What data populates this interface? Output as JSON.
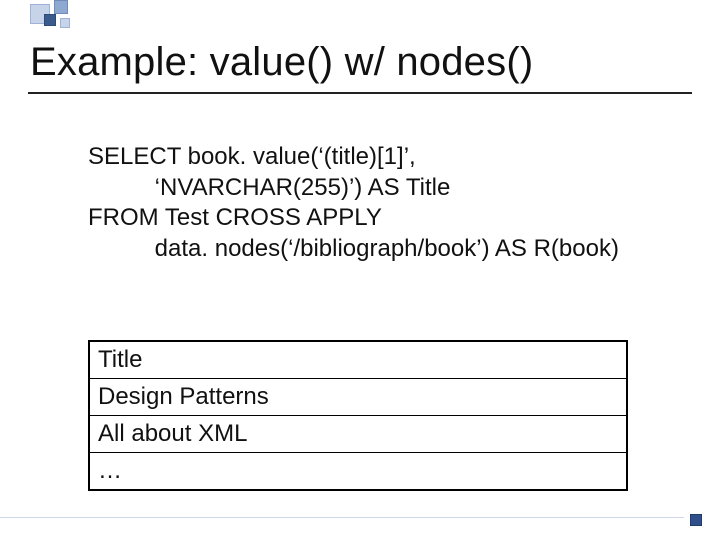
{
  "title": "Example: value() w/ nodes()",
  "code": {
    "l1": "SELECT book. value(‘(title)[1]’,",
    "l2": "          ‘NVARCHAR(255)’) AS Title",
    "l3": "FROM Test CROSS APPLY",
    "l4": "          data. nodes(‘/bibliograph/book’) AS R(book)"
  },
  "table": {
    "header": "Title",
    "rows": [
      "Design Patterns",
      "All about XML",
      "…"
    ]
  }
}
